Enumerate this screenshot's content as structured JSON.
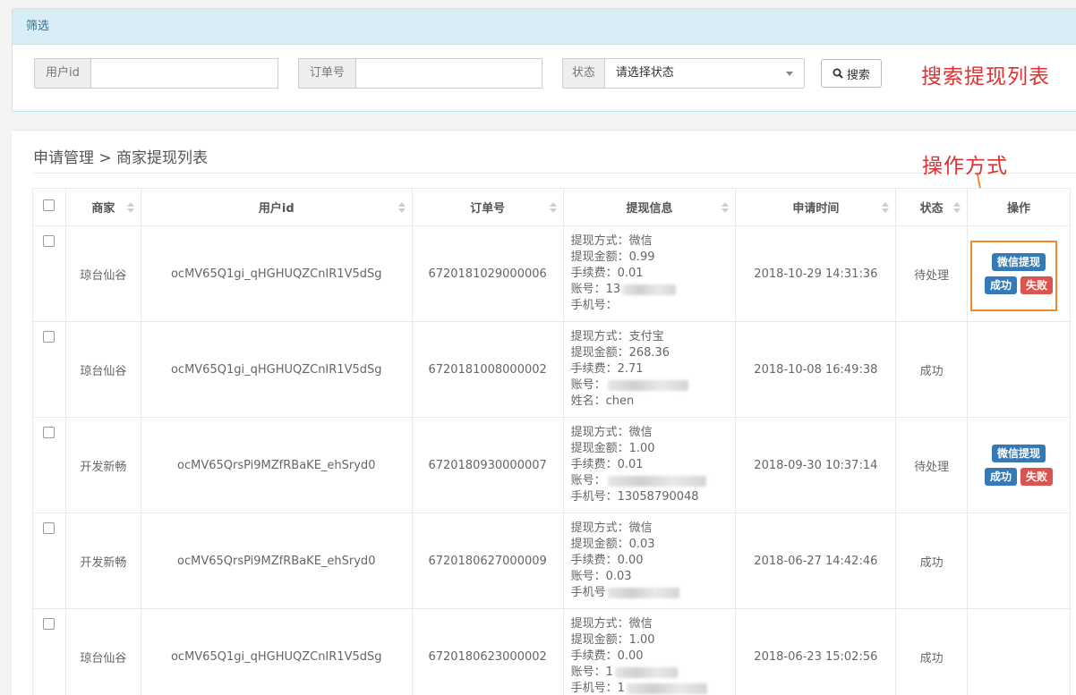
{
  "filter": {
    "header": "筛选",
    "user_id_label": "用户id",
    "order_no_label": "订单号",
    "status_label": "状态",
    "status_select": "请选择状态",
    "search_button": "搜索"
  },
  "annotations": {
    "search": "搜索提现列表",
    "operation": "操作方式"
  },
  "breadcrumb": "申请管理 > 商家提现列表",
  "table": {
    "headers": [
      "商家",
      "用户id",
      "订单号",
      "提现信息",
      "申请时间",
      "状态",
      "操作"
    ],
    "rows": [
      {
        "merchant": "琼台仙谷",
        "user_id": "ocMV65Q1gi_qHGHUQZCnIR1V5dSg",
        "order_no": "6720181029000006",
        "info": [
          "提现方式：微信",
          "提现金额：0.99",
          "手续费：0.01",
          "账号：13",
          "手机号："
        ],
        "time": "2018-10-29 14:31:36",
        "status": "待处理",
        "actions": true
      },
      {
        "merchant": "琼台仙谷",
        "user_id": "ocMV65Q1gi_qHGHUQZCnIR1V5dSg",
        "order_no": "6720181008000002",
        "info": [
          "提现方式：支付宝",
          "提现金额：268.36",
          "手续费：2.71",
          "账号：",
          "姓名：chen"
        ],
        "time": "2018-10-08 16:49:38",
        "status": "成功",
        "actions": false
      },
      {
        "merchant": "开发新畅",
        "user_id": "ocMV65QrsPi9MZfRBaKE_ehSryd0",
        "order_no": "6720180930000007",
        "info": [
          "提现方式：微信",
          "提现金额：1.00",
          "手续费：0.01",
          "账号：",
          "手机号：13058790048"
        ],
        "time": "2018-09-30 10:37:14",
        "status": "待处理",
        "actions": true
      },
      {
        "merchant": "开发新畅",
        "user_id": "ocMV65QrsPi9MZfRBaKE_ehSryd0",
        "order_no": "6720180627000009",
        "info": [
          "提现方式：微信",
          "提现金额：0.03",
          "手续费：0.00",
          "账号：0.03",
          "手机号"
        ],
        "time": "2018-06-27 14:42:46",
        "status": "成功",
        "actions": false
      },
      {
        "merchant": "琼台仙谷",
        "user_id": "ocMV65Q1gi_qHGHUQZCnIR1V5dSg",
        "order_no": "6720180623000002",
        "info": [
          "提现方式：微信",
          "提现金额：1.00",
          "手续费：0.00",
          "账号：1",
          "手机号：1"
        ],
        "time": "2018-06-23 15:02:56",
        "status": "成功",
        "actions": false
      }
    ],
    "action_labels": {
      "wechat": "微信提现",
      "success": "成功",
      "fail": "失败"
    }
  }
}
